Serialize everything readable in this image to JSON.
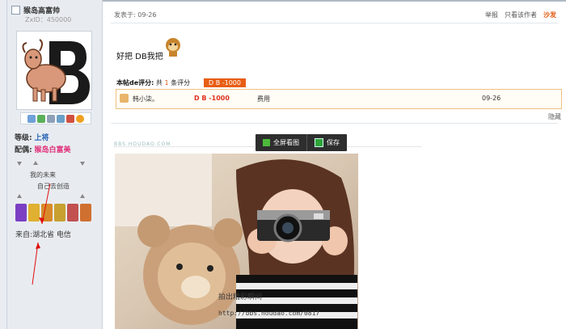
{
  "sidebar": {
    "username": "猴岛高富帅",
    "zxid": "ZxID：450000",
    "rank_label": "等级:",
    "rank_value": "上将",
    "spouse_label": "配偶:",
    "spouse_value": "猴岛白富美",
    "signature_line1": "我的未来",
    "signature_line2": "自己去创造",
    "from_label": "来自:",
    "from_value": "湖北省 电信",
    "icons": [
      "message-icon",
      "add-friend-icon",
      "profile-icon",
      "photo-icon",
      "weibo-icon",
      "qq-icon"
    ],
    "medals_colors": [
      "#7a3fc2",
      "#e0b030",
      "#d88a2a",
      "#c8a030",
      "#c25050",
      "#d07030"
    ]
  },
  "post": {
    "posted_at": "发表于: 09-26",
    "report": "举报",
    "only_author": "只看该作者",
    "sofa": "沙发",
    "message": "好把 DB我把",
    "rating": {
      "title_prefix": "本帖de评分",
      "title_mid": "共",
      "count": "1",
      "title_suffix": "条评分",
      "badge": "D B  -1000",
      "row": {
        "user": "韩小柒。",
        "score": "D B -1000",
        "reason": "费用",
        "date": "09-26"
      }
    },
    "hide_link": "隐藏"
  },
  "image": {
    "header_text": "BBS.HOUDAO.COM",
    "toolbar_fullscreen": "全屏看图",
    "toolbar_save": "保存",
    "watermark_line1": "拍出精彩瞬间",
    "watermark_line2": "http://bbs.houdao.com/0817"
  },
  "colors": {
    "accent": "#e85d14",
    "rank": "#2a64b6",
    "spouse": "#e0307a"
  }
}
